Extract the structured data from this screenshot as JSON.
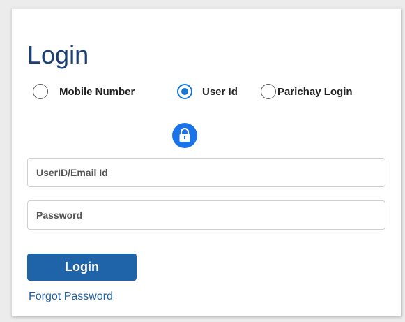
{
  "form": {
    "title": "Login",
    "login_options": [
      {
        "label": "Mobile Number",
        "selected": false
      },
      {
        "label": "User Id",
        "selected": true
      },
      {
        "label": "Parichay Login",
        "selected": false
      }
    ],
    "lock_icon": "lock-icon",
    "userid_placeholder": "UserID/Email Id",
    "userid_value": "",
    "password_placeholder": "Password",
    "password_value": "",
    "login_button_label": "Login",
    "forgot_password_label": "Forgot Password"
  },
  "colors": {
    "title": "#1b3f76",
    "accent": "#1a73e8",
    "button": "#1f63a8",
    "link": "#1f5fa8"
  }
}
